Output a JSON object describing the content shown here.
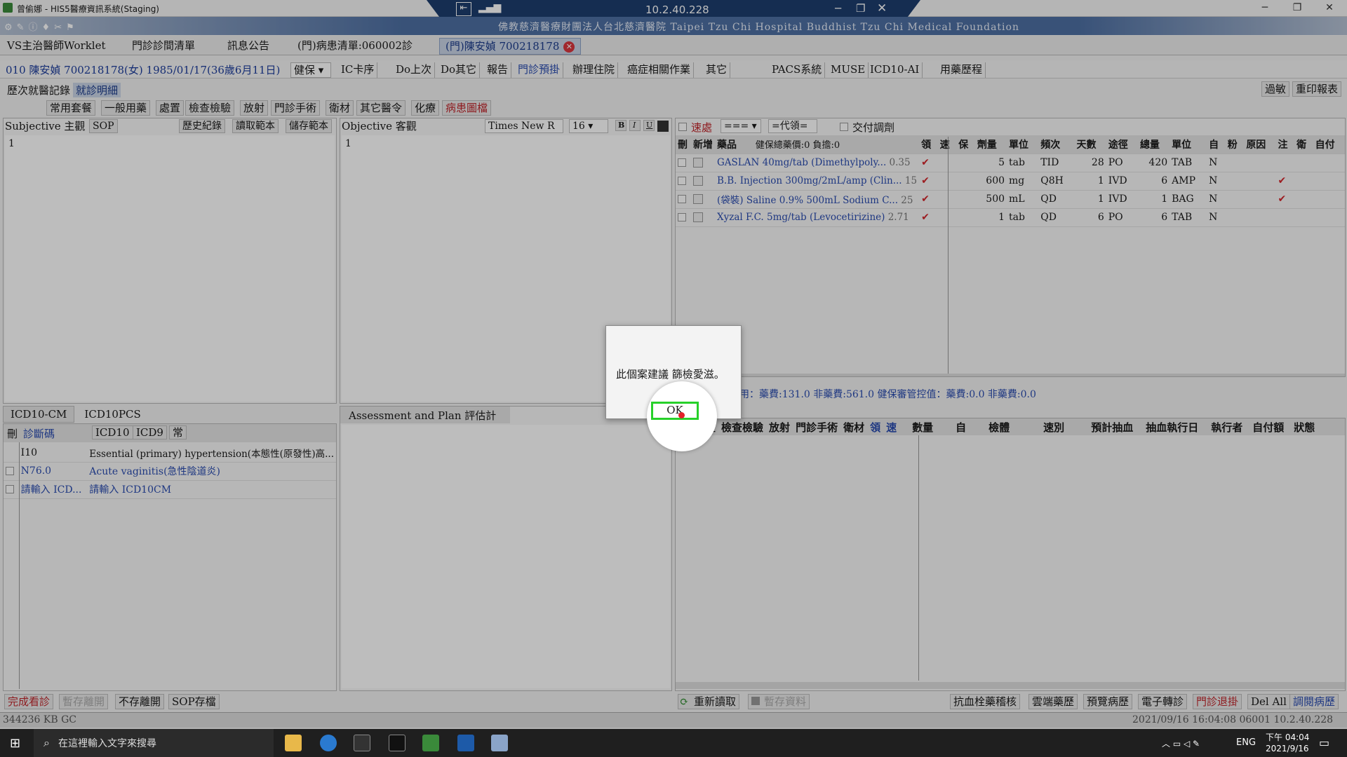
{
  "window": {
    "title": "曾偷娜 - HIS5醫療資訊系統(Staging)",
    "remote_ip": "10.2.40.228"
  },
  "banner": {
    "hospital": "佛教慈濟醫療財團法人台北慈濟醫院 Taipei Tzu Chi Hospital Buddhist Tzu Chi Medical Foundation"
  },
  "tabs": [
    {
      "label": "VS主治醫師Worklet"
    },
    {
      "label": "門診診間清單"
    },
    {
      "label": "訊息公告"
    },
    {
      "label": "(門)病患清單:060002診"
    },
    {
      "label": "(門)陳安媜 700218178"
    }
  ],
  "patient": {
    "info": "010  陳安媜 700218178(女) 1985/01/17(36歲6月11日)",
    "insurance": "健保"
  },
  "toolbar": [
    "IC卡序",
    "Do上次",
    "Do其它",
    "報告",
    "門診預掛",
    "辦理住院",
    "癌症相關作業",
    "其它",
    "PACS系統",
    "MUSE",
    "ICD10-AI",
    "用藥歷程"
  ],
  "right_buttons": [
    "過敏",
    "重印報表"
  ],
  "subtabs": [
    "歷次就醫記錄",
    "就診明細"
  ],
  "order_buttons": [
    "常用套餐",
    "一般用藥",
    "處置",
    "檢查檢驗",
    "放射",
    "門診手術",
    "衛材",
    "其它醫令",
    "化療",
    "病患圖檔"
  ],
  "subjective": {
    "title": "Subjective 主觀",
    "sop": "SOP",
    "history": "歷史紀錄",
    "read": "讀取範本",
    "save": "儲存範本",
    "content": "1"
  },
  "objective": {
    "title": "Objective 客觀",
    "font": "Times New R",
    "size": "16",
    "content": "1"
  },
  "drug_toolbar": {
    "urgent": "速處",
    "sel1": "===",
    "sel2": "=代領=",
    "deliver": "交付調劑"
  },
  "drug_headers": [
    "刪",
    "新增",
    "藥品",
    "健保總藥價:0 負擔:0",
    "領",
    "速",
    "保",
    "劑量",
    "單位",
    "頻次",
    "天數",
    "途徑",
    "總量",
    "單位",
    "自",
    "粉",
    "原因",
    "注",
    "衛",
    "自付"
  ],
  "drugs": [
    {
      "name": "GASLAN 40mg/tab (Dimethylpoly...",
      "price": "0.35",
      "dose": "5",
      "unit": "tab",
      "freq": "TID",
      "days": "28",
      "route": "PO",
      "total": "420",
      "tunit": "TAB",
      "self": "N",
      "inj": ""
    },
    {
      "name": "B.B. Injection 300mg/2mL/amp (Clin...",
      "price": "15",
      "dose": "600",
      "unit": "mg",
      "freq": "Q8H",
      "days": "1",
      "route": "IVD",
      "total": "6",
      "tunit": "AMP",
      "self": "N",
      "inj": "✔"
    },
    {
      "name": "(袋裝) Saline 0.9% 500mL Sodium C...",
      "price": "25",
      "dose": "500",
      "unit": "mL",
      "freq": "QD",
      "days": "1",
      "route": "IVD",
      "total": "1",
      "tunit": "BAG",
      "self": "N",
      "inj": "✔"
    },
    {
      "name": "Xyzal F.C. 5mg/tab (Levocetirizine)",
      "price": "2.71",
      "dose": "1",
      "unit": "tab",
      "freq": "QD",
      "days": "6",
      "route": "PO",
      "total": "6",
      "tunit": "TAB",
      "self": "N",
      "inj": ""
    }
  ],
  "fee_line": "用：藥費:131.0 非藥費:561.0 健保審管控值：藥費:0.0 非藥費:0.0",
  "order_headers": [
    "刪",
    "處置",
    "檢查檢驗",
    "放射",
    "門診手術",
    "衛材",
    "領",
    "速",
    "數量",
    "自",
    "檢體",
    "速別",
    "預計抽血",
    "抽血執行日",
    "執行者",
    "自付額",
    "狀態"
  ],
  "icd_tabs": [
    "ICD10-CM",
    "ICD10PCS"
  ],
  "icd_headers": [
    "刪",
    "診斷碼",
    "ICD10",
    "ICD9",
    "常"
  ],
  "diagnoses": [
    {
      "code": "I10",
      "desc": "Essential (primary) hypertension(本態性(原發性)高..."
    },
    {
      "code": "N76.0",
      "desc": "Acute vaginitis(急性陰道炎)"
    },
    {
      "code": "請輸入 ICD...",
      "desc": "請輸入 ICD10CM"
    }
  ],
  "assessment": {
    "title": "Assessment and Plan 評估計畫"
  },
  "bottom_left": [
    "完成看診",
    "暫存離開",
    "不存離開",
    "SOP存檔"
  ],
  "bottom_mid": [
    "重新讀取",
    "暫存資料"
  ],
  "bottom_right": [
    "抗血栓藥稽核",
    "雲端藥歷",
    "預覽病歷",
    "電子轉診",
    "門診退掛",
    "Del All",
    "調閱病歷"
  ],
  "status": {
    "left": "344236 KB GC",
    "right": "2021/09/16 16:04:08  06001  10.2.40.228"
  },
  "dialog": {
    "message": "此個案建議 篩檢愛滋。",
    "ok": "OK"
  },
  "taskbar": {
    "search": "在這裡輸入文字來搜尋",
    "lang": "ENG",
    "time": "下午 04:04",
    "date": "2021/9/16"
  }
}
